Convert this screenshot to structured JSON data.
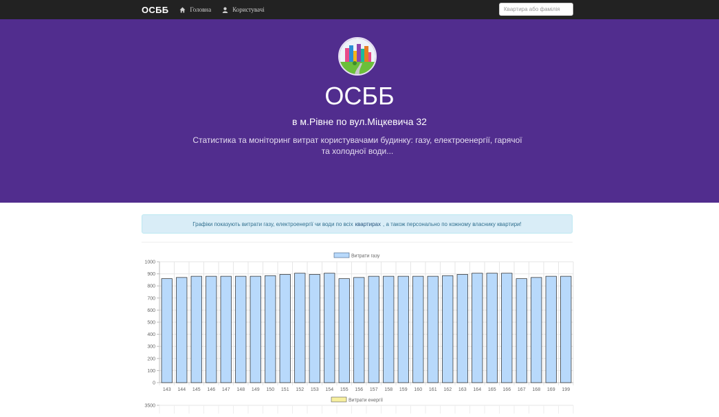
{
  "nav": {
    "brand": "ОСББ",
    "home": "Головна",
    "users": "Користувачі",
    "search_placeholder": "Квартира або фамілія"
  },
  "hero": {
    "title": "ОСББ",
    "subtitle": "в м.Рівне по вул.Міцкевича 32",
    "description": "Статистика та моніторинг витрат користувачами будинку: газу, електроенергії, гарячої та холодної води..."
  },
  "alert": {
    "before": "Графіки показують витрати газу, електроенергії чи води по всіх",
    "link": "квартирах",
    "after": ", а також персонально по кожному власнику квартири!"
  },
  "colors": {
    "hero_bg": "#512d8e",
    "nav_bg": "#222222",
    "gas_bar": "#b8d9fb",
    "energy_bar": "#f7ef9f"
  },
  "chart_data": [
    {
      "type": "bar",
      "legend": "Витрати газу",
      "legend_position": "top",
      "grid": true,
      "ylim": [
        0,
        1000
      ],
      "yticks": [
        0,
        100,
        200,
        300,
        400,
        500,
        600,
        700,
        800,
        900,
        1000
      ],
      "categories": [
        "143",
        "144",
        "145",
        "146",
        "147",
        "148",
        "149",
        "150",
        "151",
        "152",
        "153",
        "154",
        "155",
        "156",
        "157",
        "158",
        "159",
        "160",
        "161",
        "162",
        "163",
        "164",
        "165",
        "166",
        "167",
        "168",
        "169",
        "199"
      ],
      "series": [
        {
          "name": "Витрати газу",
          "values": [
            860,
            870,
            880,
            880,
            880,
            880,
            880,
            885,
            895,
            905,
            895,
            905,
            860,
            870,
            880,
            880,
            880,
            880,
            880,
            885,
            895,
            905,
            905,
            905,
            860,
            870,
            880,
            880
          ]
        }
      ]
    },
    {
      "type": "bar",
      "legend": "Витрати енергії",
      "legend_position": "top",
      "grid": true,
      "yticks": [
        3500
      ]
    }
  ]
}
